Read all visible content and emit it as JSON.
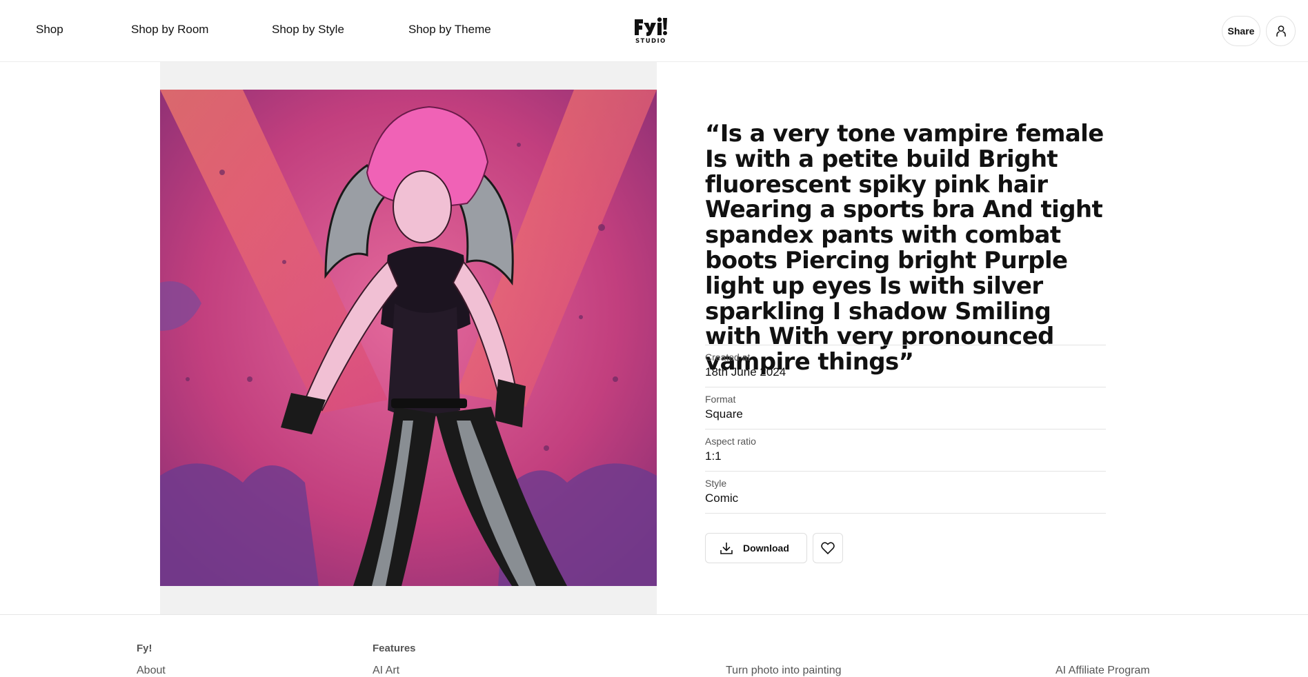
{
  "nav": {
    "shop": "Shop",
    "shop_by_room": "Shop by Room",
    "shop_by_style": "Shop by Style",
    "shop_by_theme": "Shop by Theme"
  },
  "logo": {
    "main": "FYI",
    "sub": "STUDIO",
    "icon": "fyi-studio-logo"
  },
  "header_actions": {
    "share_label": "Share",
    "user_icon": "user-icon"
  },
  "artwork": {
    "style": "comic illustration of a pink-haired vampire woman with bat wings",
    "colors": {
      "background": "#c8457e",
      "accent": "#f06b8c",
      "wings": "#e05a6e"
    }
  },
  "prompt": {
    "title": "“Is a very tone vampire female Is with a petite build Bright fluorescent spiky pink hair Wearing a sports bra And tight spandex pants with combat boots Piercing bright Purple light up eyes Is with silver sparkling I shadow Smiling with With very pronounced vampire things”"
  },
  "details": [
    {
      "label": "Created at",
      "value": "18th June 2024"
    },
    {
      "label": "Format",
      "value": "Square"
    },
    {
      "label": "Aspect ratio",
      "value": "1:1"
    },
    {
      "label": "Style",
      "value": "Comic"
    }
  ],
  "actions": {
    "download_label": "Download",
    "download_icon": "download-icon",
    "favorite_icon": "heart-icon"
  },
  "footer": {
    "col1_heading": "Fy!",
    "col1_link": "About",
    "col2_heading": "Features",
    "col2_link": "AI Art",
    "col3_link": "Turn photo into painting",
    "col4_link": "AI Affiliate Program"
  }
}
